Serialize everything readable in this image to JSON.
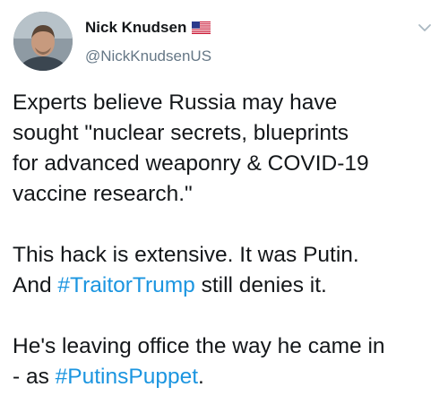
{
  "author": {
    "name": "Nick Knudsen",
    "handle": "@NickKnudsenUS",
    "flag_icon": "us-flag-icon",
    "menu_icon": "chevron-down-icon"
  },
  "tweet": {
    "para1": {
      "line1": "Experts believe Russia may have",
      "line2": "sought \"nuclear secrets, blueprints",
      "line3": "for advanced weaponry & COVID-19",
      "line4": "vaccine  research.\""
    },
    "para2": {
      "line1": "This hack is extensive. It was Putin.",
      "line2_before": "And ",
      "hashtag1": "#TraitorTrump",
      "line2_after": " still denies it."
    },
    "para3": {
      "line1": "He's leaving office the way he came in",
      "line2_before": "- as ",
      "hashtag2": "#PutinsPuppet",
      "line2_after": "."
    }
  },
  "colors": {
    "hashtag": "#1b95e0",
    "handle": "#657786",
    "text": "#14171a"
  }
}
